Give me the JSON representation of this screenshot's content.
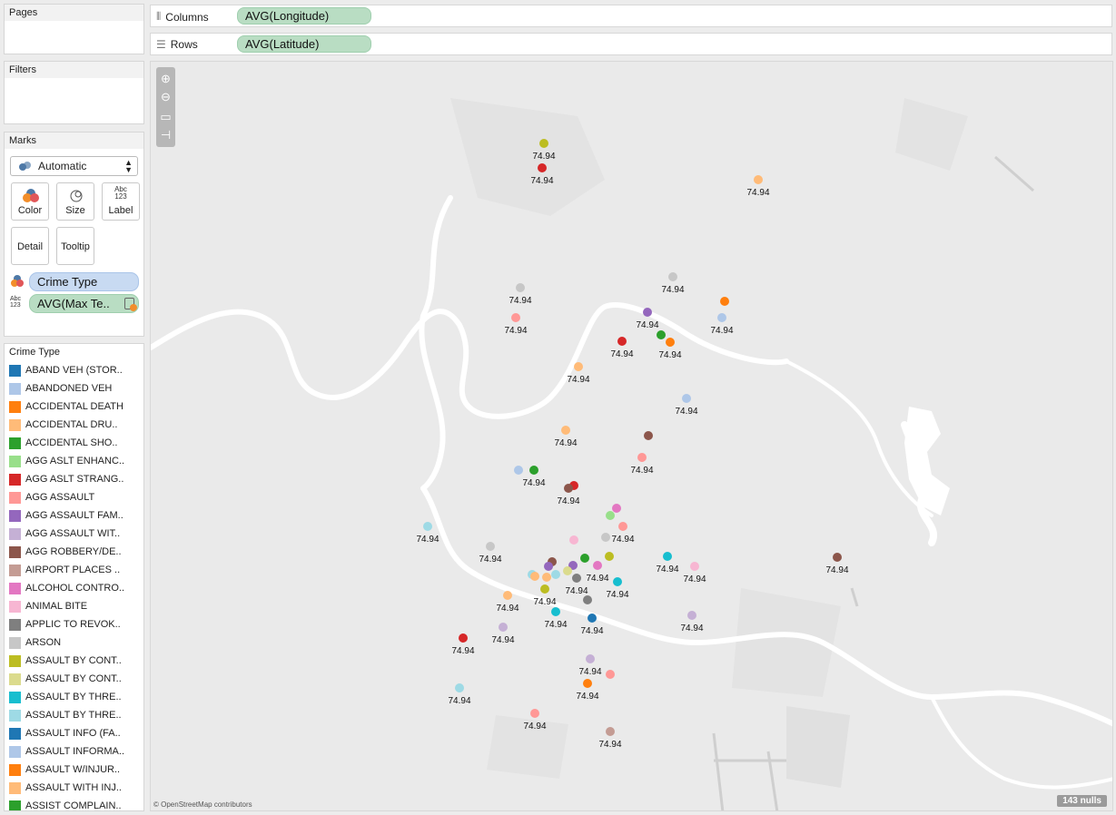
{
  "pages": {
    "title": "Pages"
  },
  "filters": {
    "title": "Filters"
  },
  "columns": {
    "label": "Columns",
    "pill": "AVG(Longitude)"
  },
  "rows": {
    "label": "Rows",
    "pill": "AVG(Latitude)"
  },
  "marks": {
    "title": "Marks",
    "type_select": "Automatic",
    "buttons": {
      "color": "Color",
      "size": "Size",
      "label": "Label",
      "detail": "Detail",
      "tooltip": "Tooltip"
    },
    "label_icon_text_1": "Abc",
    "label_icon_text_2": "123",
    "pills": {
      "color": "Crime Type",
      "label": "AVG(Max Te.."
    }
  },
  "legend": {
    "title": "Crime Type",
    "items": [
      {
        "label": "ABAND VEH  (STOR..",
        "color": "#1f77b4"
      },
      {
        "label": "ABANDONED VEH",
        "color": "#aec7e8"
      },
      {
        "label": "ACCIDENTAL DEATH",
        "color": "#ff7f0e"
      },
      {
        "label": "ACCIDENTAL DRU..",
        "color": "#ffbb78"
      },
      {
        "label": "ACCIDENTAL SHO..",
        "color": "#2ca02c"
      },
      {
        "label": "AGG ASLT ENHANC..",
        "color": "#98df8a"
      },
      {
        "label": "AGG ASLT STRANG..",
        "color": "#d62728"
      },
      {
        "label": "AGG ASSAULT",
        "color": "#ff9896"
      },
      {
        "label": "AGG ASSAULT FAM..",
        "color": "#9467bd"
      },
      {
        "label": "AGG ASSAULT WIT..",
        "color": "#c5b0d5"
      },
      {
        "label": "AGG ROBBERY/DE..",
        "color": "#8c564b"
      },
      {
        "label": "AIRPORT PLACES ..",
        "color": "#c49c94"
      },
      {
        "label": "ALCOHOL CONTRO..",
        "color": "#e377c2"
      },
      {
        "label": "ANIMAL BITE",
        "color": "#f7b6d2"
      },
      {
        "label": "APPLIC TO REVOK..",
        "color": "#7f7f7f"
      },
      {
        "label": "ARSON",
        "color": "#c7c7c7"
      },
      {
        "label": "ASSAULT BY CONT..",
        "color": "#bcbd22"
      },
      {
        "label": "ASSAULT BY CONT..",
        "color": "#dbdb8d"
      },
      {
        "label": "ASSAULT BY THRE..",
        "color": "#17becf"
      },
      {
        "label": "ASSAULT BY THRE..",
        "color": "#9edae5"
      },
      {
        "label": "ASSAULT INFO (FA..",
        "color": "#1f77b4"
      },
      {
        "label": "ASSAULT INFORMA..",
        "color": "#aec7e8"
      },
      {
        "label": "ASSAULT W/INJUR..",
        "color": "#ff7f0e"
      },
      {
        "label": "ASSAULT WITH INJ..",
        "color": "#ffbb78"
      },
      {
        "label": "ASSIST COMPLAIN..",
        "color": "#2ca02c"
      }
    ]
  },
  "map": {
    "attribution": "© OpenStreetMap contributors",
    "nulls": "143 nulls",
    "label_value": "74.94",
    "water_color": "#ffffff",
    "background_color": "#eaeaea",
    "points": [
      {
        "color": "#bcbd22",
        "label": true
      },
      {
        "color": "#d62728",
        "label": true
      },
      {
        "color": "#ffbb78",
        "label": true
      },
      {
        "color": "#c7c7c7",
        "label": true
      },
      {
        "color": "#c7c7c7",
        "label": true
      },
      {
        "color": "#ff7f0e",
        "label": false
      },
      {
        "color": "#9467bd",
        "label": true
      },
      {
        "color": "#aec7e8",
        "label": true
      },
      {
        "color": "#ff9896",
        "label": true
      },
      {
        "color": "#2ca02c",
        "label": false
      },
      {
        "color": "#ff7f0e",
        "label": true
      },
      {
        "color": "#d62728",
        "label": true
      },
      {
        "color": "#ffbb78",
        "label": true
      },
      {
        "color": "#aec7e8",
        "label": true
      },
      {
        "color": "#ffbb78",
        "label": true
      },
      {
        "color": "#8c564b",
        "label": false
      },
      {
        "color": "#ff9896",
        "label": true
      },
      {
        "color": "#aec7e8",
        "label": false
      },
      {
        "color": "#2ca02c",
        "label": true
      },
      {
        "color": "#d62728",
        "label": false
      },
      {
        "color": "#8c564b",
        "label": true
      },
      {
        "color": "#e377c2",
        "label": false
      },
      {
        "color": "#98df8a",
        "label": false
      },
      {
        "color": "#ff9896",
        "label": true
      },
      {
        "color": "#9edae5",
        "label": true
      },
      {
        "color": "#c7c7c7",
        "label": false
      },
      {
        "color": "#f7b6d2",
        "label": false
      },
      {
        "color": "#c7c7c7",
        "label": true
      },
      {
        "color": "#8c564b",
        "label": false
      },
      {
        "color": "#2ca02c",
        "label": false
      },
      {
        "color": "#bcbd22",
        "label": false
      },
      {
        "color": "#9467bd",
        "label": false
      },
      {
        "color": "#e377c2",
        "label": true
      },
      {
        "color": "#9edae5",
        "label": false
      },
      {
        "color": "#ffbb78",
        "label": false
      },
      {
        "color": "#dbdb8d",
        "label": false
      },
      {
        "color": "#9467bd",
        "label": false
      },
      {
        "color": "#7f7f7f",
        "label": true
      },
      {
        "color": "#17becf",
        "label": true
      },
      {
        "color": "#17becf",
        "label": true
      },
      {
        "color": "#f7b6d2",
        "label": true
      },
      {
        "color": "#8c564b",
        "label": true
      },
      {
        "color": "#ffbb78",
        "label": true
      },
      {
        "color": "#bcbd22",
        "label": true
      },
      {
        "color": "#7f7f7f",
        "label": false
      },
      {
        "color": "#17becf",
        "label": true
      },
      {
        "color": "#1f77b4",
        "label": true
      },
      {
        "color": "#c5b0d5",
        "label": true
      },
      {
        "color": "#c5b0d5",
        "label": true
      },
      {
        "color": "#d62728",
        "label": true
      },
      {
        "color": "#c5b0d5",
        "label": true
      },
      {
        "color": "#ff9896",
        "label": false
      },
      {
        "color": "#ff7f0e",
        "label": true
      },
      {
        "color": "#9edae5",
        "label": true
      },
      {
        "color": "#ff9896",
        "label": true
      },
      {
        "color": "#c49c94",
        "label": true
      },
      {
        "color": "#ffbb78",
        "label": false
      },
      {
        "color": "#9edae5",
        "label": false
      }
    ]
  }
}
